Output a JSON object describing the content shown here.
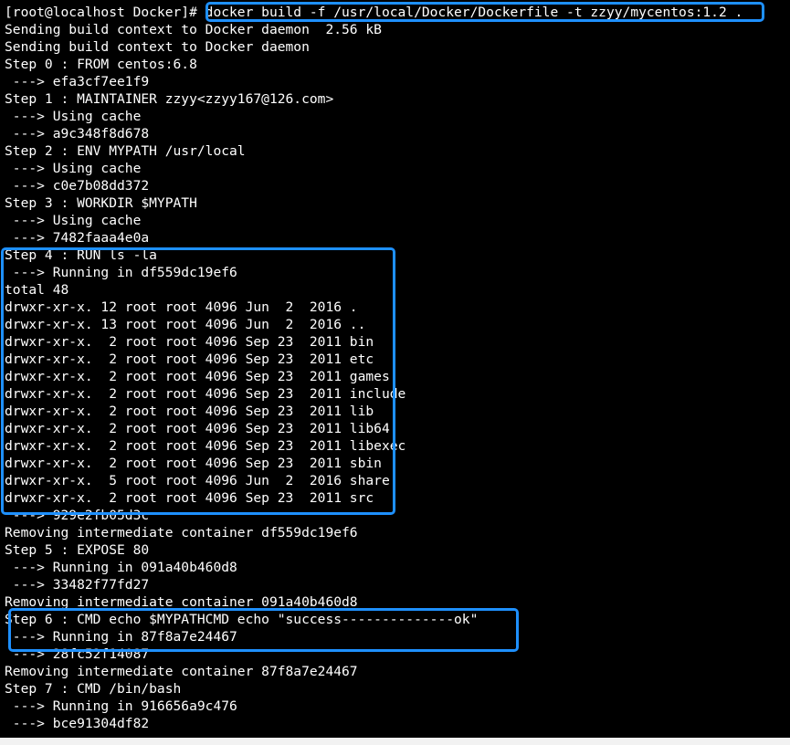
{
  "terminal": {
    "lines": [
      "[root@localhost Docker]# docker build -f /usr/local/Docker/Dockerfile -t zzyy/mycentos:1.2 .",
      "Sending build context to Docker daemon  2.56 kB",
      "Sending build context to Docker daemon",
      "Step 0 : FROM centos:6.8",
      " ---> efa3cf7ee1f9",
      "Step 1 : MAINTAINER zzyy<zzyy167@126.com>",
      " ---> Using cache",
      " ---> a9c348f8d678",
      "Step 2 : ENV MYPATH /usr/local",
      " ---> Using cache",
      " ---> c0e7b08dd372",
      "Step 3 : WORKDIR $MYPATH",
      " ---> Using cache",
      " ---> 7482faaa4e0a",
      "Step 4 : RUN ls -la",
      " ---> Running in df559dc19ef6",
      "total 48",
      "drwxr-xr-x. 12 root root 4096 Jun  2  2016 .",
      "drwxr-xr-x. 13 root root 4096 Jun  2  2016 ..",
      "drwxr-xr-x.  2 root root 4096 Sep 23  2011 bin",
      "drwxr-xr-x.  2 root root 4096 Sep 23  2011 etc",
      "drwxr-xr-x.  2 root root 4096 Sep 23  2011 games",
      "drwxr-xr-x.  2 root root 4096 Sep 23  2011 include",
      "drwxr-xr-x.  2 root root 4096 Sep 23  2011 lib",
      "drwxr-xr-x.  2 root root 4096 Sep 23  2011 lib64",
      "drwxr-xr-x.  2 root root 4096 Sep 23  2011 libexec",
      "drwxr-xr-x.  2 root root 4096 Sep 23  2011 sbin",
      "drwxr-xr-x.  5 root root 4096 Jun  2  2016 share",
      "drwxr-xr-x.  2 root root 4096 Sep 23  2011 src",
      " ---> 929e2fb05d3c",
      "Removing intermediate container df559dc19ef6",
      "Step 5 : EXPOSE 80",
      " ---> Running in 091a40b460d8",
      " ---> 33482f77fd27",
      "Removing intermediate container 091a40b460d8",
      "Step 6 : CMD echo $MYPATHCMD echo \"success--------------ok\"",
      " ---> Running in 87f8a7e24467",
      " ---> 28fc52f14087",
      "Removing intermediate container 87f8a7e24467",
      "Step 7 : CMD /bin/bash",
      " ---> Running in 916656a9c476",
      " ---> bce91304df82"
    ]
  },
  "colors": {
    "background": "#000000",
    "text": "#ffffff",
    "highlight": "#1e90ff"
  }
}
